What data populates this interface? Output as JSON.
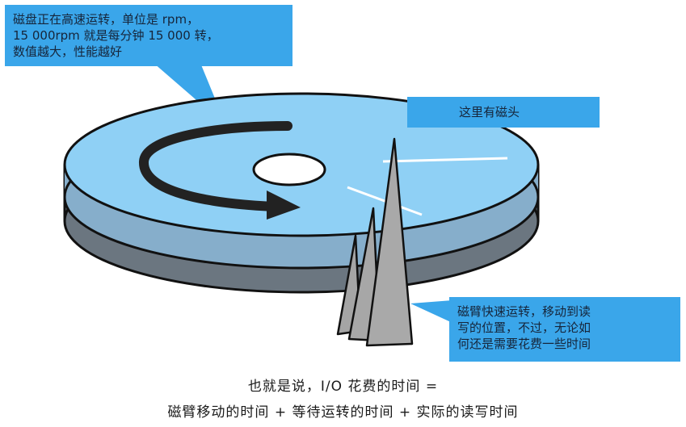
{
  "callouts": {
    "speed": {
      "line1": "磁盘正在高速运转，单位是 rpm，",
      "line2": "15 000rpm 就是每分钟 15 000 转，",
      "line3": "数值越大，性能越好"
    },
    "head": {
      "text": "这里有磁头"
    },
    "arm": {
      "line1": "磁臂快速运转，移动到读",
      "line2": "写的位置，不过，无论如",
      "line3": "何还是需要花费一些时间"
    }
  },
  "caption": {
    "line1": "也就是说，I/O 花费的时间 =",
    "line2": "磁臂移动的时间 + 等待运转的时间 + 实际的读写时间"
  },
  "colors": {
    "platter_top": "#8fd0f5",
    "platter_middle": "#86aecb",
    "platter_bottom": "#6b7680",
    "callout": "#3aa6ea",
    "arm": "#a9a9a9"
  }
}
